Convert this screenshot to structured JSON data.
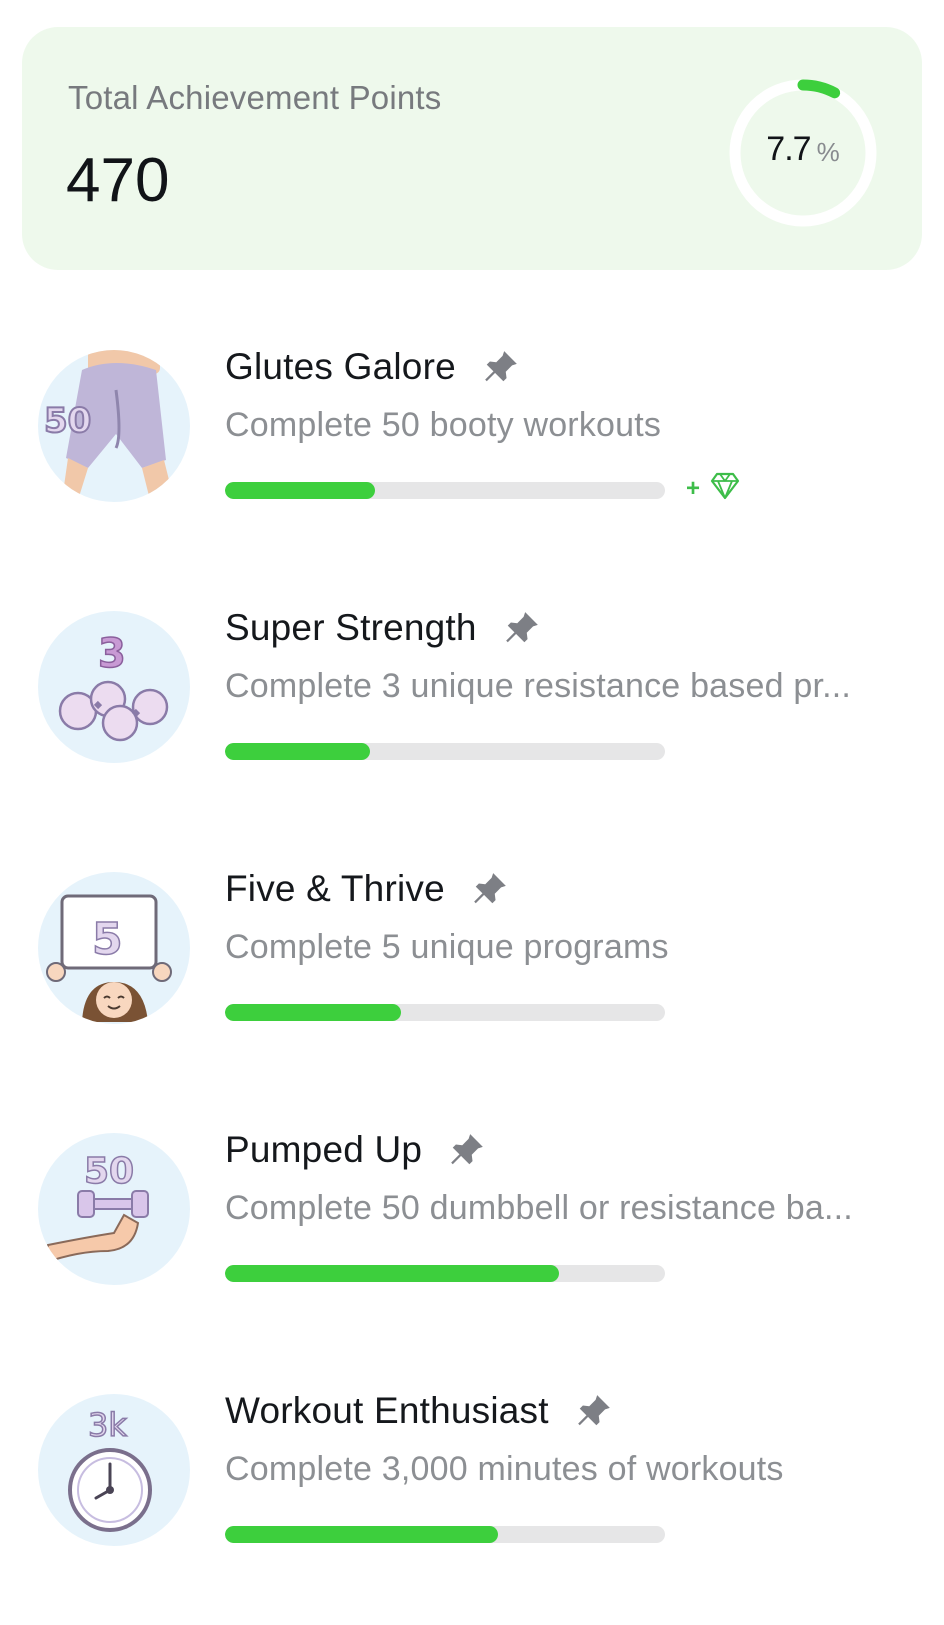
{
  "summary": {
    "label": "Total Achievement Points",
    "points": "470",
    "percent_value": "7.7",
    "percent_unit": "%",
    "progress_fraction": 0.077,
    "ring_color": "#3dcf3d",
    "card_color": "#eef9ec"
  },
  "achievements": [
    {
      "title": "Glutes Galore",
      "description": "Complete 50 booty workouts",
      "progress": 0.34,
      "badge_icon": "booty-50-icon",
      "badge_text": "50",
      "reward": "+",
      "reward_icon": "diamond-icon"
    },
    {
      "title": "Super Strength",
      "description": "Complete 3 unique resistance based pr...",
      "progress": 0.33,
      "badge_icon": "kettlebells-3-icon",
      "badge_text": "3"
    },
    {
      "title": "Five & Thrive",
      "description": "Complete 5 unique programs",
      "progress": 0.4,
      "badge_icon": "sign-5-icon",
      "badge_text": "5"
    },
    {
      "title": "Pumped Up",
      "description": "Complete 50 dumbbell or resistance ba...",
      "progress": 0.76,
      "badge_icon": "flexed-arm-50-icon",
      "badge_text": "50"
    },
    {
      "title": "Workout Enthusiast",
      "description": "Complete 3,000 minutes of workouts",
      "progress": 0.62,
      "badge_icon": "clock-3k-icon",
      "badge_text": "3k"
    }
  ],
  "colors": {
    "progress_fill": "#3dcf3d",
    "progress_track": "#e6e6e7",
    "pin": "#7d7f85",
    "badge_bg": "#e6f3fb",
    "badge_art": "#c9b8dc"
  }
}
